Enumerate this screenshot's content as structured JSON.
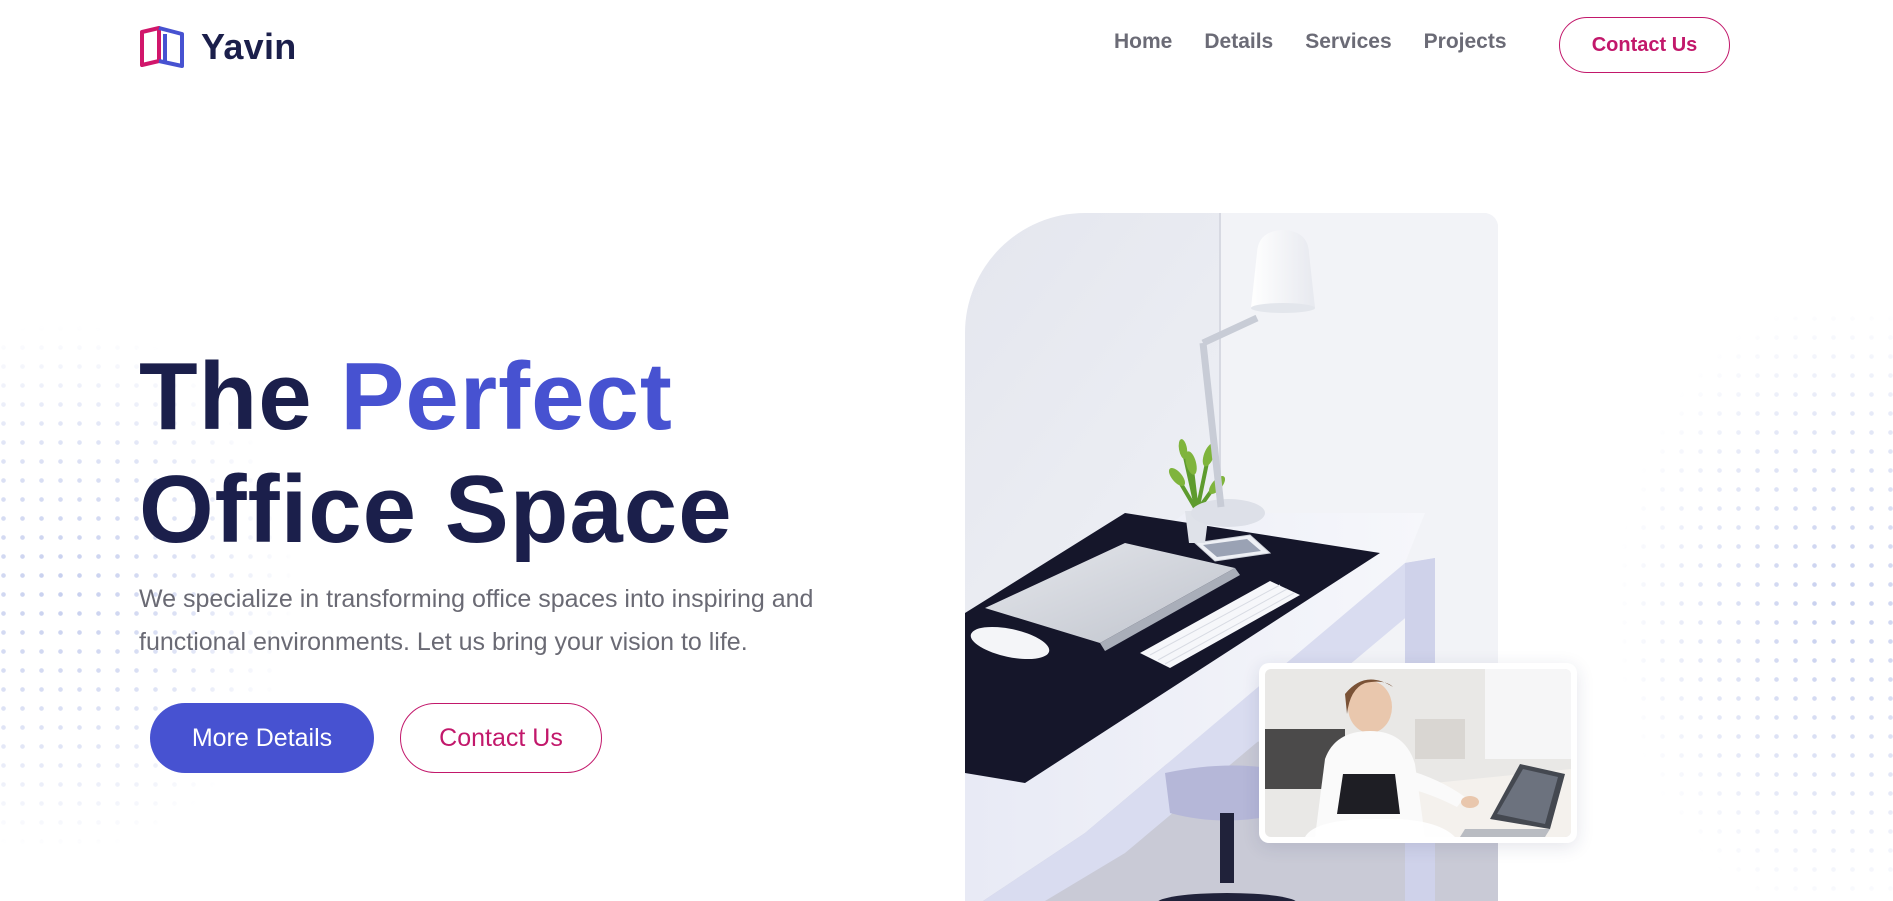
{
  "brand": {
    "name": "Yavin",
    "logo_icon": "open-book-icon",
    "colors": {
      "pink": "#c2186b",
      "blue": "#4752d1"
    }
  },
  "nav": {
    "items": [
      {
        "label": "Home"
      },
      {
        "label": "Details"
      },
      {
        "label": "Services"
      },
      {
        "label": "Projects"
      }
    ]
  },
  "header": {
    "cta_label": "Contact Us"
  },
  "hero": {
    "title_word1": "The",
    "title_accent": "Perfect",
    "title_line2": "Office Space",
    "description": "We specialize in transforming office spaces into inspiring and functional environments. Let us bring your vision to life.",
    "primary_button": "More Details",
    "secondary_button": "Contact Us",
    "colors": {
      "heading": "#1b1f4b",
      "accent": "#4752d1",
      "cta": "#c2186b"
    }
  },
  "images": {
    "main": "office-desk-photo",
    "inset": "woman-working-photo"
  }
}
